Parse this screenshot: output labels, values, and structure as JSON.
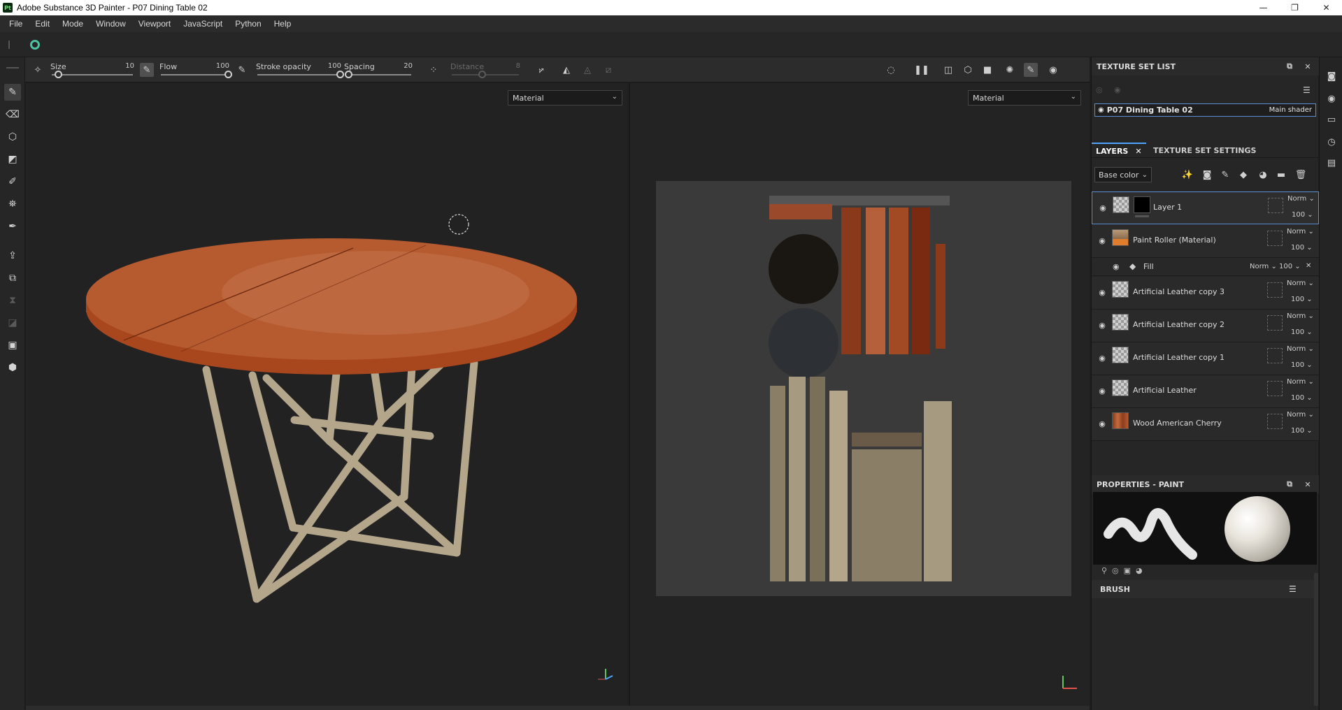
{
  "window": {
    "title": "Adobe Substance 3D Painter - P07 Dining Table 02",
    "app_icon": "Pt",
    "minimize": "—",
    "maximize": "❐",
    "close": "✕"
  },
  "menu": {
    "items": [
      "File",
      "Edit",
      "Mode",
      "Window",
      "Viewport",
      "JavaScript",
      "Python",
      "Help"
    ]
  },
  "toolbar": {
    "size": {
      "label": "Size",
      "value": "10",
      "level": 0.08
    },
    "flow": {
      "label": "Flow",
      "value": "100",
      "level": 1.0
    },
    "stroke_opacity": {
      "label": "Stroke opacity",
      "value": "100",
      "level": 1.0
    },
    "spacing": {
      "label": "Spacing",
      "value": "20",
      "level": 0.05
    },
    "distance": {
      "label": "Distance",
      "value": "8",
      "level": 0.45
    }
  },
  "viewport3d": {
    "material_select": "Material"
  },
  "viewport2d": {
    "material_select": "Material"
  },
  "texture_set_list": {
    "title": "TEXTURE SET LIST",
    "entry_name": "P07 Dining Table 02",
    "entry_shader": "Main shader"
  },
  "layers_panel": {
    "tab_layers": "LAYERS",
    "tab_settings": "TEXTURE SET SETTINGS",
    "channel": "Base color",
    "layers": [
      {
        "name": "Layer 1",
        "blend": "Norm",
        "opacity": "100"
      },
      {
        "name": "Paint Roller (Material)",
        "blend": "Norm",
        "opacity": "100"
      },
      {
        "name": "Artificial Leather copy 3",
        "blend": "Norm",
        "opacity": "100"
      },
      {
        "name": "Artificial Leather copy 2",
        "blend": "Norm",
        "opacity": "100"
      },
      {
        "name": "Artificial Leather copy 1",
        "blend": "Norm",
        "opacity": "100"
      },
      {
        "name": "Artificial Leather",
        "blend": "Norm",
        "opacity": "100"
      },
      {
        "name": "Wood American Cherry",
        "blend": "Norm",
        "opacity": "100"
      }
    ],
    "fill": {
      "name": "Fill",
      "blend": "Norm",
      "opacity": "100"
    }
  },
  "properties": {
    "title": "PROPERTIES - PAINT",
    "brush_section": "BRUSH"
  },
  "colors": {
    "accent": "#4da3ff",
    "wood": "#b65a30",
    "metal": "#b3a68b"
  }
}
